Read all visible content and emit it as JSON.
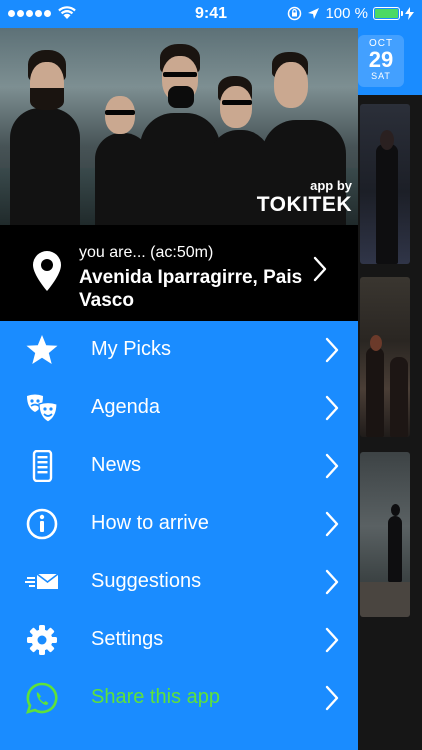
{
  "status_bar": {
    "time": "9:41",
    "battery_text": "100 %",
    "battery_level": 1.0
  },
  "background": {
    "date_badge": {
      "month": "OCT",
      "day": "29",
      "weekday": "SAT"
    }
  },
  "hero": {
    "app_by": "app by",
    "brand": "TOKITEK"
  },
  "location": {
    "prefix": "you are... (ac:50m)",
    "address": "Avenida Iparragirre, Pais Vasco"
  },
  "menu": {
    "items": [
      {
        "label": "My Picks",
        "icon": "star-icon"
      },
      {
        "label": "Agenda",
        "icon": "theater-masks-icon"
      },
      {
        "label": "News",
        "icon": "news-phone-icon"
      },
      {
        "label": "How to arrive",
        "icon": "info-circle-icon"
      },
      {
        "label": "Suggestions",
        "icon": "envelope-send-icon"
      },
      {
        "label": "Settings",
        "icon": "gear-icon"
      },
      {
        "label": "Share this app",
        "icon": "whatsapp-icon"
      }
    ]
  },
  "colors": {
    "drawer_blue": "#1a8cff",
    "location_bar": "#000000",
    "share_green": "#5ee23a"
  }
}
